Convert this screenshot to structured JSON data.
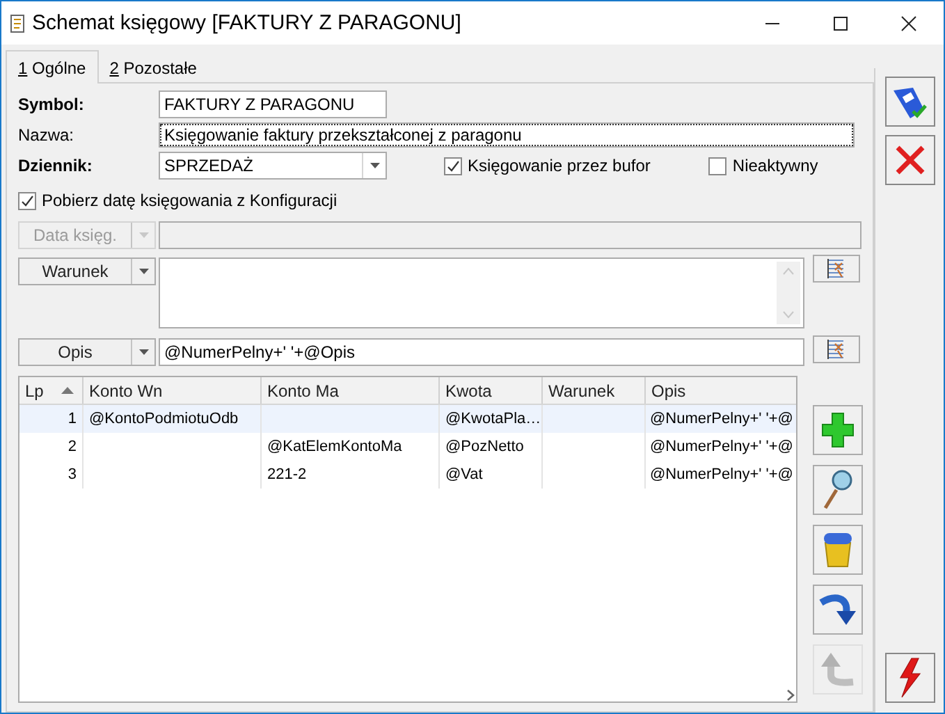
{
  "window": {
    "title": "Schemat księgowy [FAKTURY Z PARAGONU]"
  },
  "tabs": [
    {
      "hotkey": "1",
      "label": "Ogólne",
      "selected": true
    },
    {
      "hotkey": "2",
      "label": "Pozostałe",
      "selected": false
    }
  ],
  "symbol": {
    "label": "Symbol:",
    "value": "FAKTURY Z PARAGONU"
  },
  "nazwa": {
    "label": "Nazwa:",
    "value": "Księgowanie faktury przekształconej z paragonu"
  },
  "dziennik": {
    "label": "Dziennik:",
    "value": "SPRZEDAŻ"
  },
  "buffer_checkbox": {
    "label": "Księgowanie przez bufor",
    "checked": true
  },
  "inactive_checkbox": {
    "label": "Nieaktywny",
    "checked": false
  },
  "config_date_checkbox": {
    "label": "Pobierz datę księgowania z Konfiguracji",
    "checked": true
  },
  "date_button": {
    "label": "Data księg.",
    "disabled": true
  },
  "condition_button": {
    "label": "Warunek",
    "disabled": false
  },
  "description": {
    "button": "Opis",
    "value": "@NumerPelny+' '+@Opis"
  },
  "table": {
    "columns": [
      {
        "label": "Lp",
        "sorted": true
      },
      {
        "label": "Konto Wn",
        "sorted": false
      },
      {
        "label": "Konto Ma",
        "sorted": false
      },
      {
        "label": "Kwota",
        "sorted": false
      },
      {
        "label": "Warunek",
        "sorted": false
      },
      {
        "label": "Opis",
        "sorted": false
      }
    ],
    "rows": [
      {
        "selected": true,
        "cells": [
          "1",
          "@KontoPodmiotuOdb",
          "",
          "@KwotaPla…",
          "",
          "@NumerPelny+' '+@"
        ]
      },
      {
        "selected": false,
        "cells": [
          "2",
          "",
          "@KatElemKontoMa",
          "@PozNetto",
          "",
          "@NumerPelny+' '+@"
        ]
      },
      {
        "selected": false,
        "cells": [
          "3",
          "",
          "221-2",
          "@Vat",
          "",
          "@NumerPelny+' '+@"
        ]
      }
    ]
  },
  "table_tools": [
    {
      "kind": "add",
      "disabled": false
    },
    {
      "kind": "preview",
      "disabled": false
    },
    {
      "kind": "delete",
      "disabled": false
    },
    {
      "kind": "redo",
      "disabled": false
    },
    {
      "kind": "undo",
      "disabled": true
    }
  ]
}
